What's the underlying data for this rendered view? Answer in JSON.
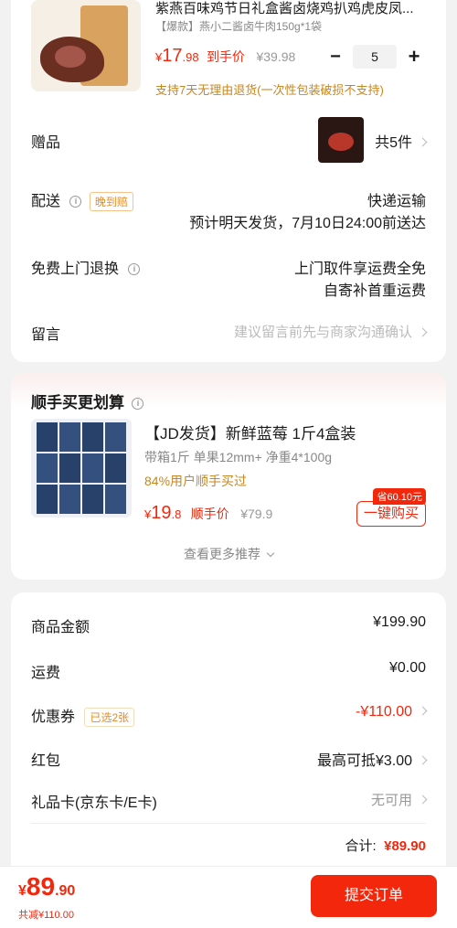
{
  "product": {
    "title": "紫燕百味鸡节日礼盒酱卤烧鸡扒鸡虎皮凤...",
    "spec": "【爆款】燕小二酱卤牛肉150g*1袋",
    "price_symbol": "¥",
    "price_int": "17",
    "price_dec": ".98",
    "price_label": "到手价",
    "orig_price": "¥39.98",
    "qty": "5",
    "minus": "−",
    "plus": "+",
    "return_policy": "支持7天无理由退货(一次性包装破损不支持)"
  },
  "gift": {
    "label": "赠品",
    "count": "共5件"
  },
  "delivery": {
    "label": "配送",
    "tag": "晚到赔",
    "method": "快递运输",
    "eta": "预计明天发货，7月10日24:00前送达"
  },
  "return_service": {
    "label": "免费上门退换",
    "line1": "上门取件享运费全免",
    "line2": "自寄补首重运费"
  },
  "message": {
    "label": "留言",
    "placeholder": "建议留言前先与商家沟通确认"
  },
  "addon": {
    "section_title": "顺手买更划算",
    "title": "【JD发货】新鲜蓝莓 1斤4盒装",
    "spec": "带箱1斤 单果12mm+ 净重4*100g",
    "stat": "84%用户顺手买过",
    "price_symbol": "¥",
    "price_int": "19",
    "price_dec": ".8",
    "price_label": "顺手价",
    "orig_price": "¥79.9",
    "save_badge": "省60.10元",
    "buy_button": "一键购买",
    "more": "查看更多推荐"
  },
  "summary": {
    "goods_label": "商品金额",
    "goods_value": "¥199.90",
    "shipping_label": "运费",
    "shipping_value": "¥0.00",
    "coupon_label": "优惠券",
    "coupon_tag": "已选2张",
    "coupon_value": "-¥110.00",
    "redpacket_label": "红包",
    "redpacket_value": "最高可抵¥3.00",
    "giftcard_label": "礼品卡(京东卡/E卡)",
    "giftcard_value": "无可用",
    "total_label": "合计:",
    "total_value": "¥89.90"
  },
  "bottom_bar": {
    "price_symbol": "¥",
    "price_int": "89",
    "price_dec": ".90",
    "discount": "共减¥110.00",
    "submit": "提交订单"
  },
  "colors": {
    "accent": "#f2270c",
    "orange": "#e8891c"
  }
}
